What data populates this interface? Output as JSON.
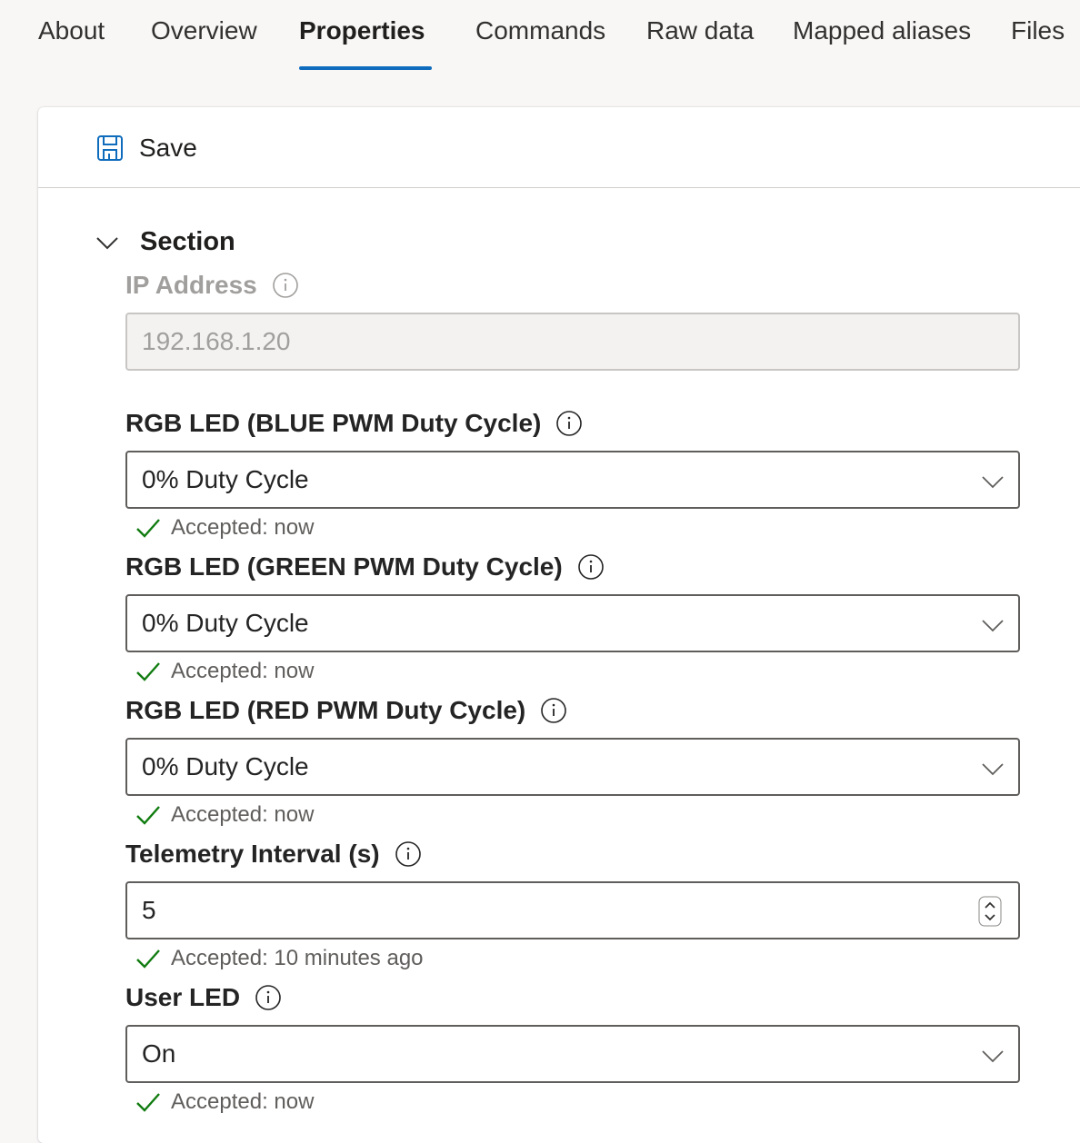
{
  "tabs": [
    {
      "label": "About"
    },
    {
      "label": "Overview"
    },
    {
      "label": "Properties"
    },
    {
      "label": "Commands"
    },
    {
      "label": "Raw data"
    },
    {
      "label": "Mapped aliases"
    },
    {
      "label": "Files"
    }
  ],
  "active_tab": "Properties",
  "toolbar": {
    "save_label": "Save"
  },
  "section": {
    "title": "Section"
  },
  "fields": {
    "ip": {
      "label": "IP Address",
      "value": "192.168.1.20"
    },
    "blue": {
      "label": "RGB LED (BLUE PWM Duty Cycle)",
      "value": "0% Duty Cycle",
      "status": "Accepted: now"
    },
    "green": {
      "label": "RGB LED (GREEN PWM Duty Cycle)",
      "value": "0% Duty Cycle",
      "status": "Accepted: now"
    },
    "red": {
      "label": "RGB LED (RED PWM Duty Cycle)",
      "value": "0% Duty Cycle",
      "status": "Accepted: now"
    },
    "telemetry": {
      "label": "Telemetry Interval (s)",
      "value": "5",
      "status": "Accepted: 10 minutes ago"
    },
    "userled": {
      "label": "User LED",
      "value": "On",
      "status": "Accepted: now"
    }
  },
  "colors": {
    "accent": "#0f6cbd",
    "success": "#107c10"
  },
  "icons": [
    "save-icon",
    "chevron-down-icon",
    "info-icon",
    "checkmark-icon",
    "spin-arrows-icon"
  ]
}
